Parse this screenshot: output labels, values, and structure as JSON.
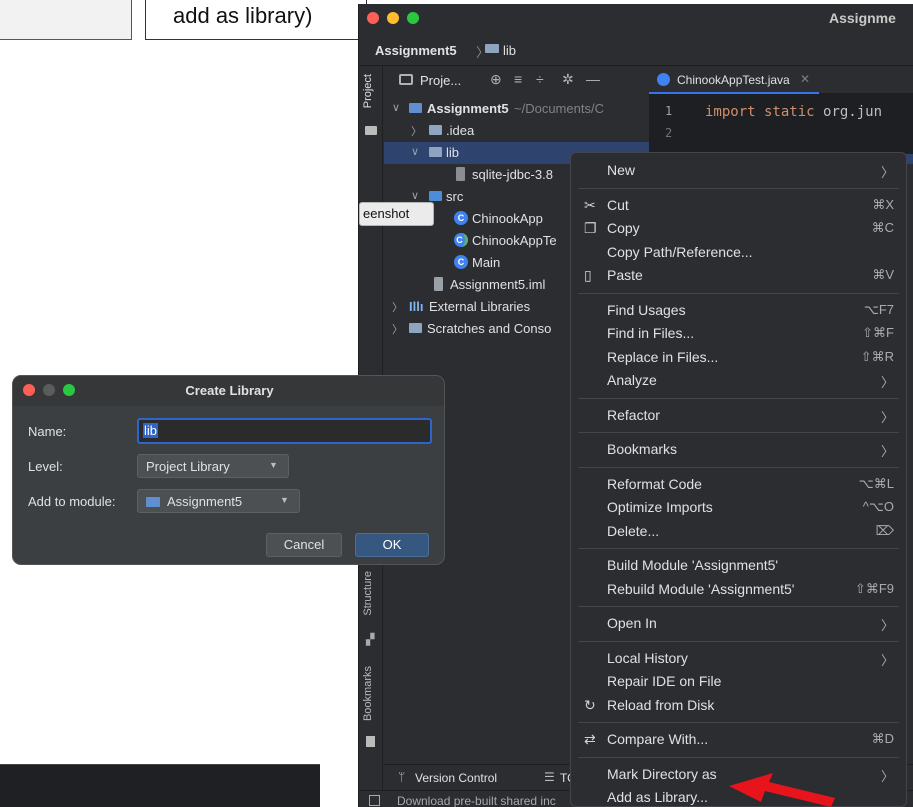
{
  "callout": {
    "text": "add as library)"
  },
  "ide": {
    "title": "Assignme",
    "breadcrumb": {
      "project": "Assignment5",
      "folder": "lib"
    },
    "left_tabs": {
      "project": "Project",
      "structure": "Structure",
      "bookmarks": "Bookmarks"
    },
    "project_panel": {
      "label": "Proje..."
    },
    "tree": [
      {
        "label": "Assignment5",
        "suffix": " ~/Documents/C",
        "level": 0,
        "expanded": true,
        "kind": "module"
      },
      {
        "label": ".idea",
        "level": 1,
        "expanded": false,
        "kind": "folder"
      },
      {
        "label": "lib",
        "level": 1,
        "expanded": true,
        "kind": "folder",
        "selected": true
      },
      {
        "label": "sqlite-jdbc-3.8",
        "level": 2,
        "kind": "jar"
      },
      {
        "label": "src",
        "level": 1,
        "expanded": true,
        "kind": "folder"
      },
      {
        "label": "ChinookApp",
        "level": 2,
        "kind": "class"
      },
      {
        "label": "ChinookAppTe",
        "level": 2,
        "kind": "test-class"
      },
      {
        "label": "Main",
        "level": 2,
        "kind": "main-class"
      },
      {
        "label": "Assignment5.iml",
        "level": 1,
        "kind": "iml"
      },
      {
        "label": "External Libraries",
        "level": 0,
        "expanded": false,
        "kind": "libraries"
      },
      {
        "label": "Scratches and Conso",
        "level": 0,
        "expanded": false,
        "kind": "scratches"
      }
    ],
    "tooltip": "eenshot",
    "editor": {
      "tab_label": "ChinookAppTest.java",
      "line_numbers": [
        "1",
        "2"
      ],
      "code_keyword": "import static ",
      "code_pkg": "org.jun"
    },
    "bottom_tabs": {
      "version_control": "Version Control",
      "todo": "TO"
    },
    "status_text": "Download pre-built shared inc"
  },
  "context_menu": {
    "items": [
      {
        "label": "New",
        "shortcut": "",
        "submenu": true,
        "icon": ""
      },
      {
        "sep": true
      },
      {
        "label": "Cut",
        "shortcut": "⌘X",
        "icon": "scissors-icon"
      },
      {
        "label": "Copy",
        "shortcut": "⌘C",
        "icon": "copy-icon"
      },
      {
        "label": "Copy Path/Reference...",
        "shortcut": ""
      },
      {
        "label": "Paste",
        "shortcut": "⌘V",
        "icon": "clipboard-icon"
      },
      {
        "sep": true
      },
      {
        "label": "Find Usages",
        "shortcut": "⌥F7"
      },
      {
        "label": "Find in Files...",
        "shortcut": "⇧⌘F"
      },
      {
        "label": "Replace in Files...",
        "shortcut": "⇧⌘R"
      },
      {
        "label": "Analyze",
        "shortcut": "",
        "submenu": true
      },
      {
        "sep": true
      },
      {
        "label": "Refactor",
        "shortcut": "",
        "submenu": true
      },
      {
        "sep": true
      },
      {
        "label": "Bookmarks",
        "shortcut": "",
        "submenu": true
      },
      {
        "sep": true
      },
      {
        "label": "Reformat Code",
        "shortcut": "⌥⌘L"
      },
      {
        "label": "Optimize Imports",
        "shortcut": "^⌥O"
      },
      {
        "label": "Delete...",
        "shortcut": "⌦"
      },
      {
        "sep": true
      },
      {
        "label": "Build Module 'Assignment5'",
        "shortcut": ""
      },
      {
        "label": "Rebuild Module 'Assignment5'",
        "shortcut": "⇧⌘F9"
      },
      {
        "sep": true
      },
      {
        "label": "Open In",
        "shortcut": "",
        "submenu": true
      },
      {
        "sep": true
      },
      {
        "label": "Local History",
        "shortcut": "",
        "submenu": true
      },
      {
        "label": "Repair IDE on File",
        "shortcut": ""
      },
      {
        "label": "Reload from Disk",
        "shortcut": "",
        "icon": "reload-icon"
      },
      {
        "sep": true
      },
      {
        "label": "Compare With...",
        "shortcut": "⌘D",
        "icon": "compare-icon"
      },
      {
        "sep": true
      },
      {
        "label": "Mark Directory as",
        "shortcut": "",
        "submenu": true
      },
      {
        "label": "Add as Library...",
        "shortcut": ""
      }
    ]
  },
  "dialog": {
    "title": "Create Library",
    "name_label": "Name:",
    "name_value": "lib",
    "level_label": "Level:",
    "level_value": "Project Library",
    "module_label": "Add to module:",
    "module_value": "Assignment5",
    "cancel": "Cancel",
    "ok": "OK"
  },
  "colors": {
    "accent": "#3574f0",
    "arrow": "#e8141b",
    "panel": "#2b2d30"
  }
}
